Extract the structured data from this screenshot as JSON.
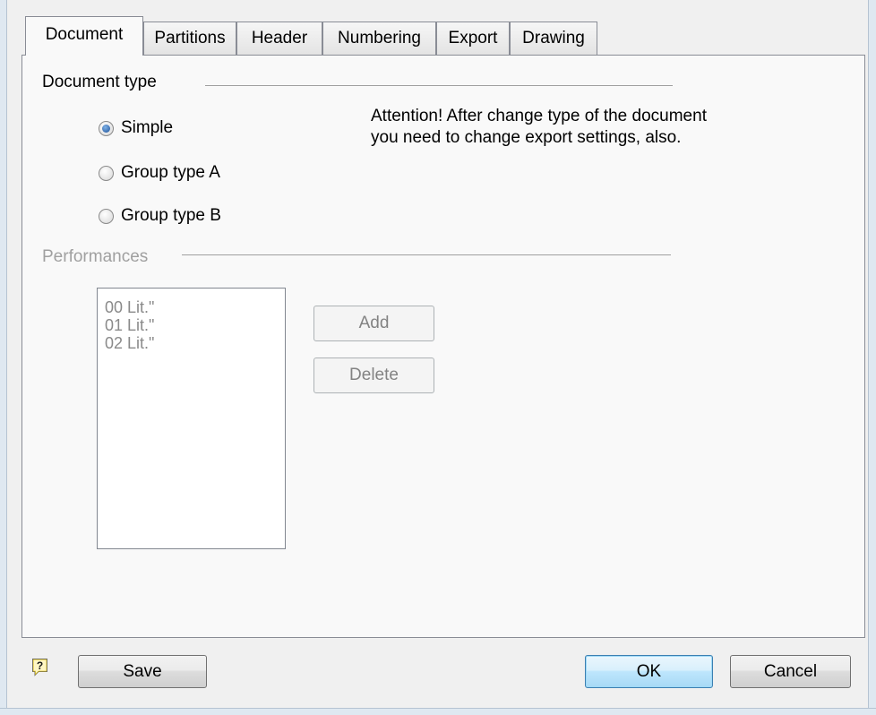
{
  "tabs": [
    {
      "label": "Document",
      "active": true
    },
    {
      "label": "Partitions",
      "active": false
    },
    {
      "label": "Header",
      "active": false
    },
    {
      "label": "Numbering",
      "active": false
    },
    {
      "label": "Export",
      "active": false
    },
    {
      "label": "Drawing",
      "active": false
    }
  ],
  "document_type": {
    "group_label": "Document type",
    "options": [
      {
        "label": "Simple",
        "checked": true
      },
      {
        "label": "Group type A",
        "checked": false
      },
      {
        "label": "Group type B",
        "checked": false
      }
    ],
    "attention_text": "Attention! After change type of the document you need to change export settings, also."
  },
  "performances": {
    "group_label": "Performances",
    "enabled": false,
    "items": [
      "00 Lit.\"",
      "01 Lit.\"",
      "02 Lit.\""
    ],
    "add_label": "Add",
    "delete_label": "Delete"
  },
  "footer": {
    "help_icon": "help-icon",
    "save_label": "Save",
    "ok_label": "OK",
    "cancel_label": "Cancel"
  },
  "colors": {
    "default_button_border": "#3c7fb1",
    "radio_selected": "#1b4f96",
    "disabled_text": "#a0a0a0"
  }
}
